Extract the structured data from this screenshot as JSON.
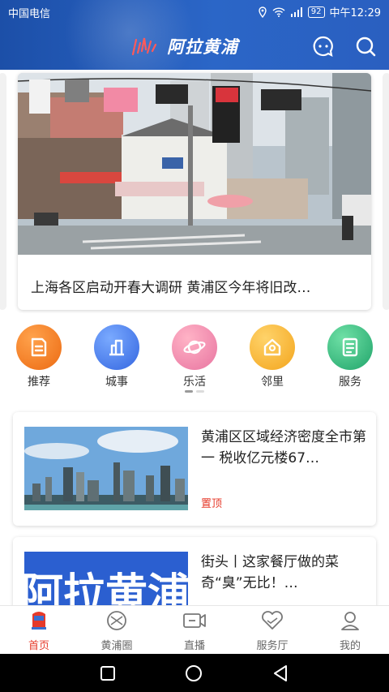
{
  "status_bar": {
    "carrier": "中国电信",
    "battery": "92",
    "time": "中午12:29"
  },
  "header": {
    "app_name": "阿拉黄浦",
    "message_icon": "message-icon",
    "search_icon": "search-icon"
  },
  "carousel": {
    "title": "上海各区启动开春大调研 黄浦区今年将旧改…"
  },
  "categories": [
    {
      "label": "推荐",
      "icon": "recommend-icon",
      "color": "#f07a22"
    },
    {
      "label": "城事",
      "icon": "city-icon",
      "color": "#3e7ff0"
    },
    {
      "label": "乐活",
      "icon": "planet-icon",
      "color": "#f58aa6"
    },
    {
      "label": "邻里",
      "icon": "neighbor-icon",
      "color": "#f6b73c"
    },
    {
      "label": "服务",
      "icon": "service-icon",
      "color": "#2bb27b"
    }
  ],
  "news": [
    {
      "title": "黄浦区区域经济密度全市第一 税收亿元楼67…",
      "tag": "置顶"
    },
    {
      "title": "街头丨这家餐厅做的菜奇“臭”无比！…",
      "thumb_text": "阿拉黄浦"
    }
  ],
  "bottom_nav": [
    {
      "label": "首页",
      "icon": "home-icon",
      "active": true
    },
    {
      "label": "黄浦圈",
      "icon": "circle-icon",
      "active": false
    },
    {
      "label": "直播",
      "icon": "live-icon",
      "active": false
    },
    {
      "label": "服务厅",
      "icon": "service-hall-icon",
      "active": false
    },
    {
      "label": "我的",
      "icon": "profile-icon",
      "active": false
    }
  ],
  "colors": {
    "header": "#2b66c7",
    "accent_red": "#e63a2a"
  }
}
